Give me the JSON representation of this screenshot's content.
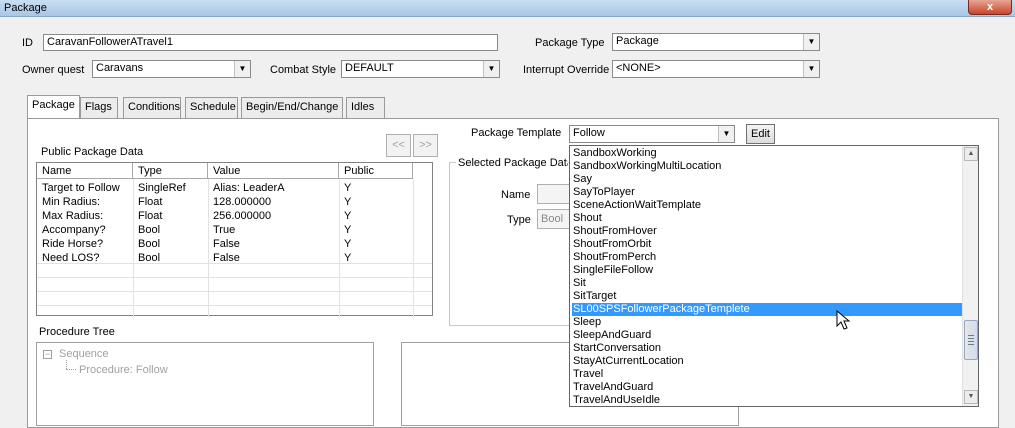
{
  "window": {
    "title": "Package",
    "close_label": "x"
  },
  "form": {
    "id_label": "ID",
    "id_value": "CaravanFollowerATravel1",
    "package_type_label": "Package Type",
    "package_type_value": "Package",
    "owner_quest_label": "Owner quest",
    "owner_quest_value": "Caravans",
    "combat_style_label": "Combat Style",
    "combat_style_value": "DEFAULT",
    "interrupt_override_label": "Interrupt Override",
    "interrupt_override_value": "<NONE>"
  },
  "tabs": [
    "Package",
    "Flags",
    "Conditions",
    "Schedule",
    "Begin/End/Change",
    "Idles"
  ],
  "package_tab": {
    "nav_prev": "<<",
    "nav_next": ">>",
    "public_data_label": "Public Package Data",
    "columns": [
      "Name",
      "Type",
      "Value",
      "Public"
    ],
    "rows": [
      [
        "Target to Follow",
        "SingleRef",
        "Alias: LeaderA",
        "Y"
      ],
      [
        "Min Radius:",
        "Float",
        "128.000000",
        "Y"
      ],
      [
        "Max Radius:",
        "Float",
        "256.000000",
        "Y"
      ],
      [
        "Accompany?",
        "Bool",
        "True",
        "Y"
      ],
      [
        "Ride Horse?",
        "Bool",
        "False",
        "Y"
      ],
      [
        "Need LOS?",
        "Bool",
        "False",
        "Y"
      ]
    ],
    "procedure_tree_label": "Procedure Tree",
    "tree": {
      "root": "Sequence",
      "child": "Procedure: Follow"
    },
    "template_label": "Package Template",
    "template_value": "Follow",
    "edit_label": "Edit",
    "selected_group_label": "Selected Package Data",
    "name_label": "Name",
    "type_label": "Type",
    "type_value": "Bool"
  },
  "template_list": {
    "items": [
      "SandboxWorking",
      "SandboxWorkingMultiLocation",
      "Say",
      "SayToPlayer",
      "SceneActionWaitTemplate",
      "Shout",
      "ShoutFromHover",
      "ShoutFromOrbit",
      "ShoutFromPerch",
      "SingleFileFollow",
      "Sit",
      "SitTarget",
      "SL00SPSFollowerPackageTemplete",
      "Sleep",
      "SleepAndGuard",
      "StartConversation",
      "StayAtCurrentLocation",
      "Travel",
      "TravelAndGuard",
      "TravelAndUseIdle"
    ],
    "selected": "SL00SPSFollowerPackageTemplete"
  }
}
